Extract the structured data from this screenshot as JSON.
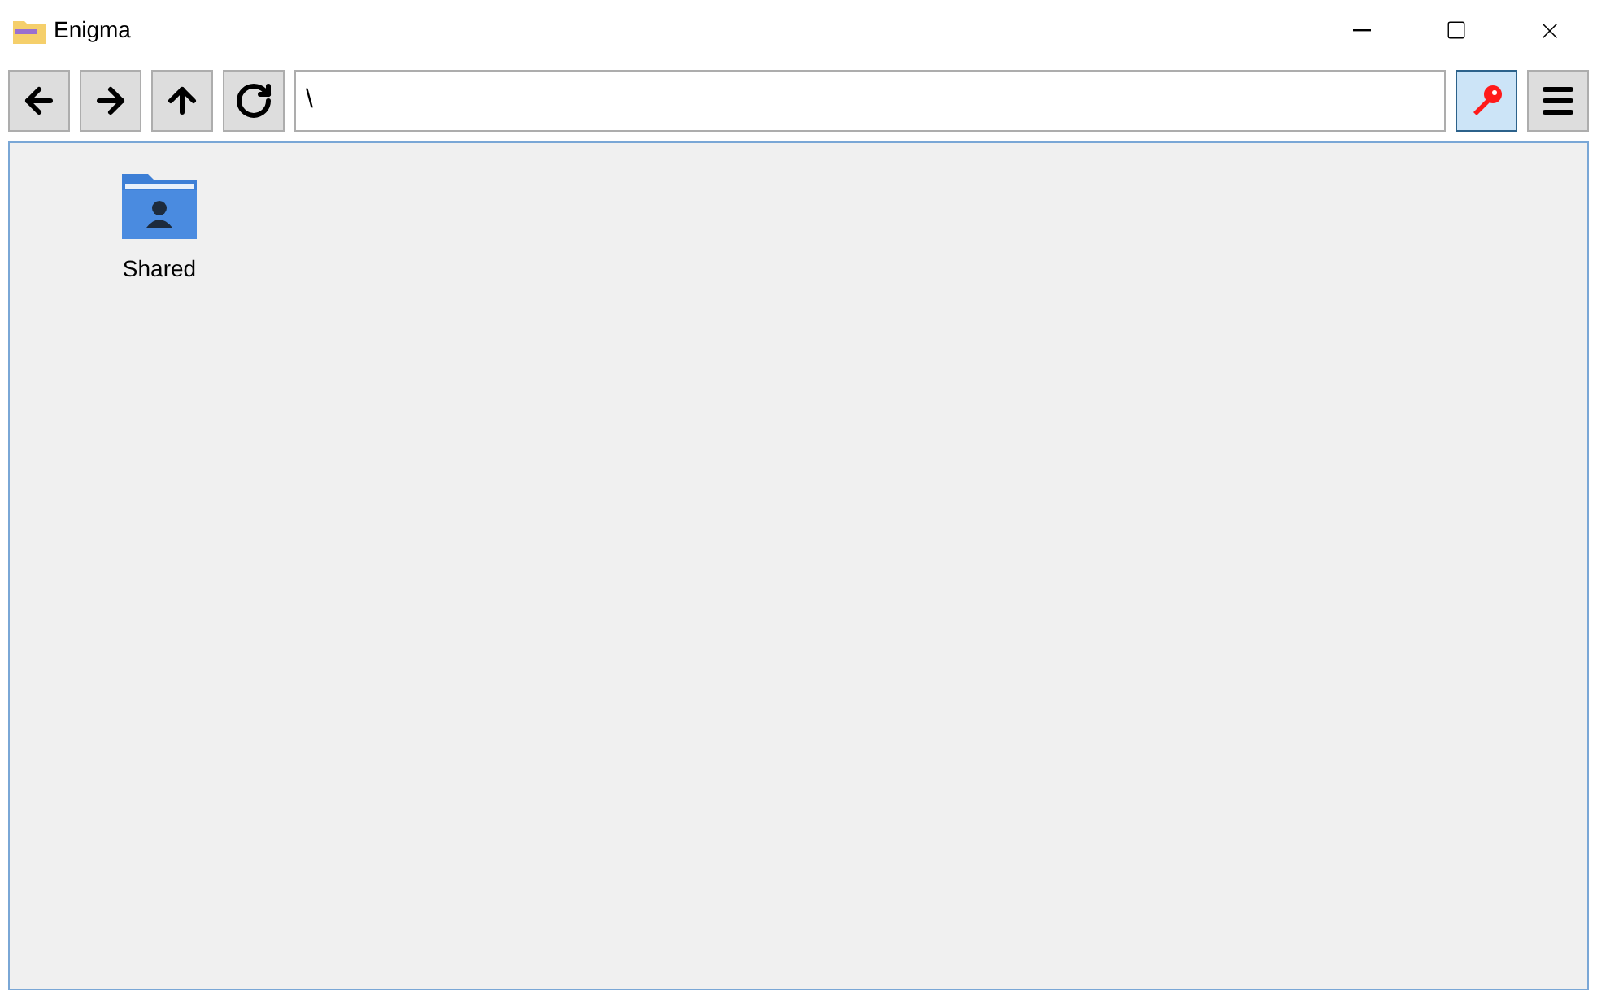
{
  "window": {
    "title": "Enigma"
  },
  "toolbar": {
    "nav_buttons": [
      {
        "kind": "back"
      },
      {
        "kind": "forward"
      },
      {
        "kind": "up"
      },
      {
        "kind": "refresh"
      }
    ],
    "address": {
      "value": "\\"
    },
    "key_button": {
      "highlighted": true
    }
  },
  "files": [
    {
      "name": "Shared",
      "kind": "shared-folder"
    }
  ]
}
